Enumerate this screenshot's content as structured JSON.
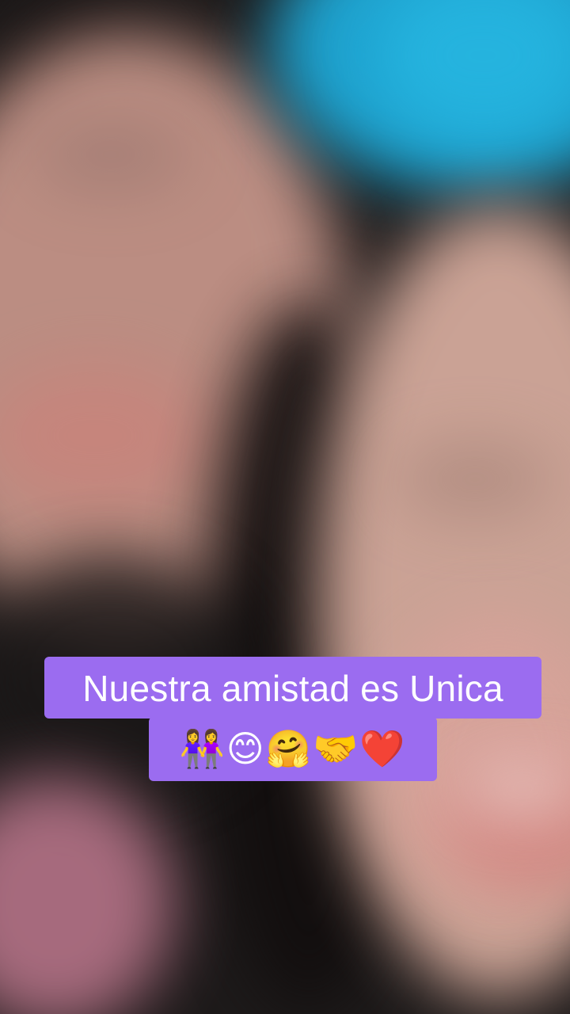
{
  "caption": {
    "line1": "Nuestra amistad es Unica",
    "line2": "👭😊🤗🤝❤️"
  },
  "colors": {
    "caption_background": "#9b6cf0",
    "caption_text": "#ffffff"
  }
}
